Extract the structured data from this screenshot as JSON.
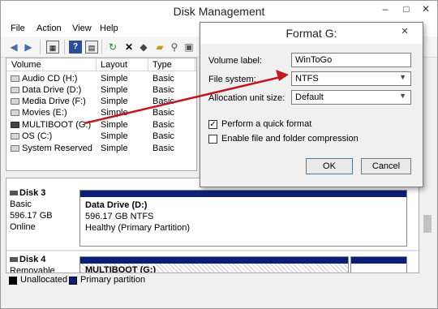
{
  "window": {
    "title": "Disk Management",
    "minimize": "–",
    "maximize": "□",
    "close": "✕"
  },
  "menu": [
    "File",
    "Action",
    "View",
    "Help"
  ],
  "volume_list": {
    "headers": {
      "volume": "Volume",
      "layout": "Layout",
      "type": "Type"
    },
    "rows": [
      {
        "name": "Audio CD (H:)",
        "layout": "Simple",
        "type": "Basic",
        "icon": "drive-icon"
      },
      {
        "name": "Data Drive (D:)",
        "layout": "Simple",
        "type": "Basic",
        "icon": "drive-icon"
      },
      {
        "name": "Media Drive (F:)",
        "layout": "Simple",
        "type": "Basic",
        "icon": "drive-icon"
      },
      {
        "name": "Movies (E:)",
        "layout": "Simple",
        "type": "Basic",
        "icon": "drive-icon"
      },
      {
        "name": "MULTIBOOT (G:)",
        "layout": "Simple",
        "type": "Basic",
        "icon": "usb-drive-icon"
      },
      {
        "name": "OS (C:)",
        "layout": "Simple",
        "type": "Basic",
        "icon": "drive-icon"
      },
      {
        "name": "System Reserved",
        "layout": "Simple",
        "type": "Basic",
        "icon": "drive-icon"
      }
    ]
  },
  "disks": [
    {
      "name": "Disk 3",
      "type": "Basic",
      "size": "596.17 GB",
      "status": "Online",
      "partition": {
        "name": "Data Drive  (D:)",
        "size": "596.17 GB NTFS",
        "status": "Healthy (Primary Partition)"
      }
    },
    {
      "name": "Disk 4",
      "type": "Removable",
      "partition": {
        "name": "MULTIBOOT  (G:)"
      }
    }
  ],
  "legend": [
    {
      "label": "Unallocated",
      "color": "#000000"
    },
    {
      "label": "Primary partition",
      "color": "#0a1f7a"
    }
  ],
  "format_dialog": {
    "title": "Format G:",
    "close": "✕",
    "volume_label": {
      "label": "Volume label:",
      "value": "WinToGo"
    },
    "file_system": {
      "label": "File system:",
      "value": "NTFS"
    },
    "allocation": {
      "label": "Allocation unit size:",
      "value": "Default"
    },
    "quick_format": {
      "label": "Perform a quick format",
      "checked": true,
      "mark": "✓"
    },
    "compression": {
      "label": "Enable file and folder compression",
      "checked": false
    },
    "ok": "OK",
    "cancel": "Cancel"
  },
  "annotation_color": "#c0181e"
}
